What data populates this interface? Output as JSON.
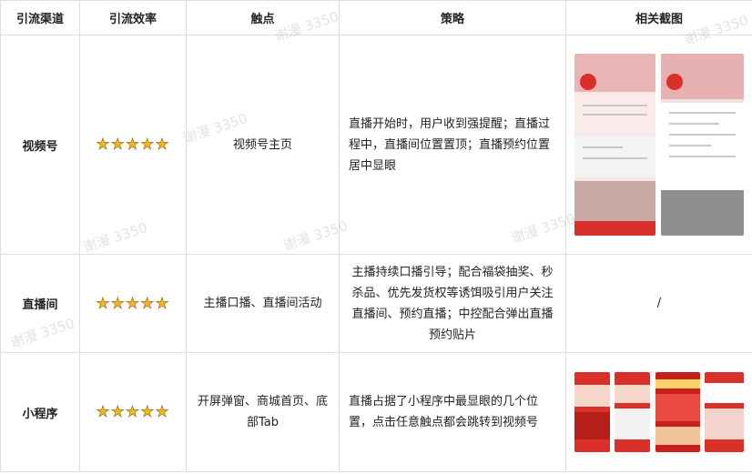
{
  "headers": {
    "channel": "引流渠道",
    "efficiency": "引流效率",
    "touchpoint": "触点",
    "strategy": "策略",
    "screenshot": "相关截图"
  },
  "rows": [
    {
      "channel": "视频号",
      "stars": "★★★★★",
      "rating": 5,
      "touchpoint": "视频号主页",
      "strategy": "直播开始时，用户收到强提醒；直播过程中，直播间位置置顶；直播预约位置居中显眼",
      "screenshot": ""
    },
    {
      "channel": "直播间",
      "stars": "★★★★★",
      "rating": 5,
      "touchpoint": "主播口播、直播间活动",
      "strategy": "主播持续口播引导；配合福袋抽奖、秒杀品、优先发货权等诱饵吸引用户关注直播间、预约直播；中控配合弹出直播预约贴片",
      "screenshot": "/"
    },
    {
      "channel": "小程序",
      "stars": "★★★★★",
      "rating": 5,
      "touchpoint": "开屏弹窗、商城首页、底部Tab",
      "strategy": "直播占据了小程序中最显眼的几个位置，点击任意触点都会跳转到视频号",
      "screenshot": ""
    }
  ],
  "watermark": "谢漫 3350",
  "colors": {
    "star": "#f3b61f",
    "border": "#dedede",
    "brand_red": "#d9302a"
  }
}
